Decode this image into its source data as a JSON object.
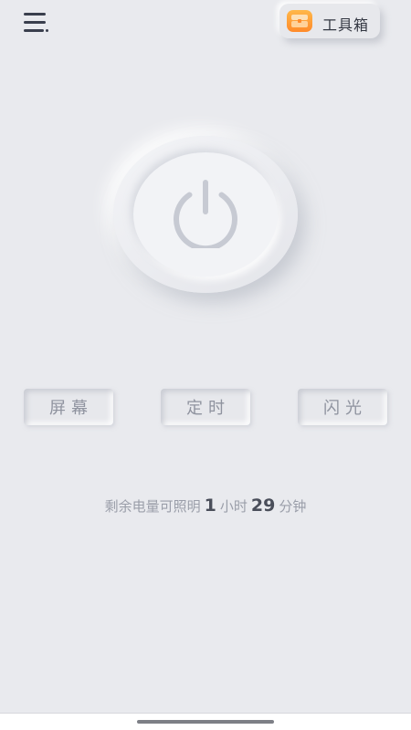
{
  "header": {
    "menu_icon": "hamburger-menu-icon",
    "toolbox": {
      "icon": "toolbox-icon",
      "label": "工具箱",
      "icon_color": "#ff9a36"
    }
  },
  "main": {
    "power_icon": "power-icon",
    "power_icon_color": "#c7cad3",
    "modes": [
      {
        "label": "屏幕"
      },
      {
        "label": "定时"
      },
      {
        "label": "闪光"
      }
    ],
    "remaining": {
      "prefix": "剩余电量可照明",
      "hours": "1",
      "hours_unit": "小时",
      "minutes": "29",
      "minutes_unit": "分钟"
    }
  },
  "colors": {
    "background": "#e9eaee",
    "text_muted": "#9a9ea9",
    "text_strong": "#4a4e5a"
  }
}
